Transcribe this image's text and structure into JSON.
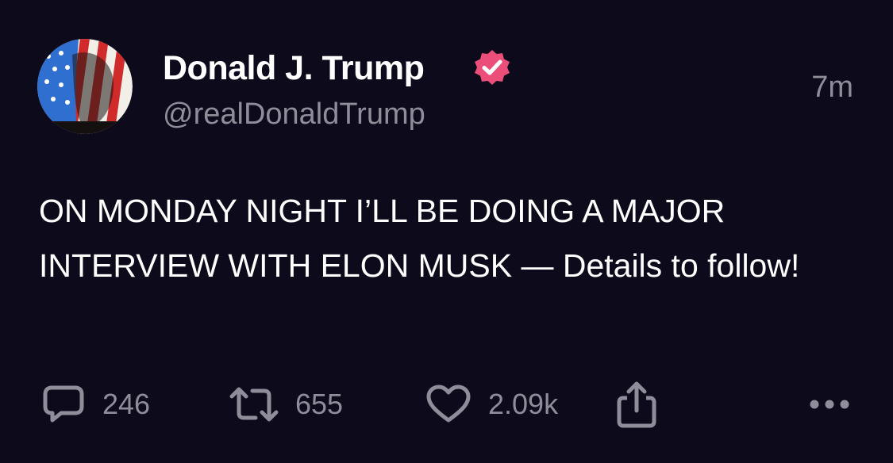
{
  "post": {
    "author": {
      "display_name": "Donald J. Trump",
      "handle": "@realDonaldTrump",
      "verified": true,
      "avatar_icon": "flag-portrait-avatar"
    },
    "timestamp": "7m",
    "text": "ON MONDAY NIGHT I’LL BE DOING A MAJOR INTERVIEW WITH ELON MUSK — Details to follow!",
    "actions": {
      "replies": "246",
      "reposts": "655",
      "likes": "2.09k"
    }
  },
  "colors": {
    "background": "#0c0a1b",
    "text": "#ffffff",
    "muted": "#8e8d99",
    "verified_badge": "#ea4e79"
  }
}
